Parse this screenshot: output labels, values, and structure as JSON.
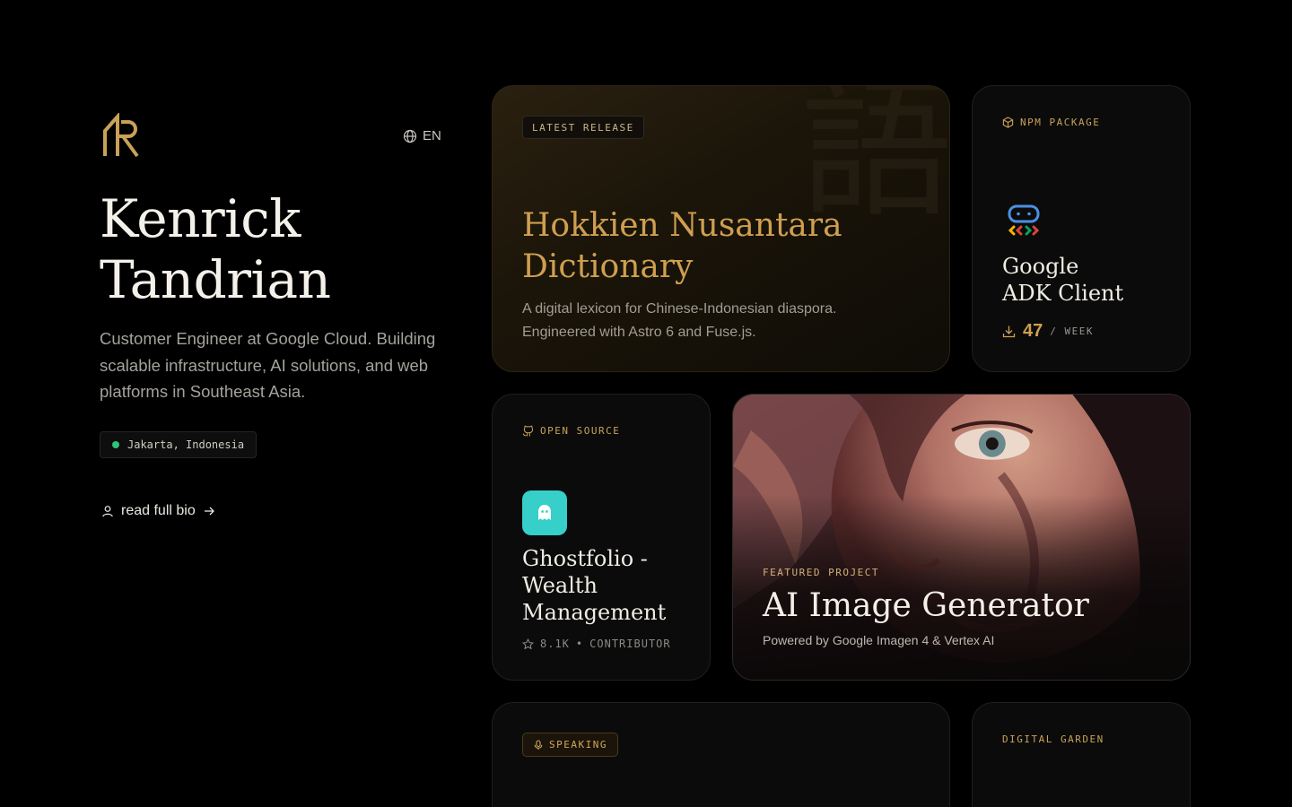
{
  "header": {
    "language": "EN"
  },
  "profile": {
    "name_line1": "Kenrick",
    "name_line2": "Tandrian",
    "bio": "Customer Engineer at Google Cloud. Building scalable infrastructure, AI solutions, and web platforms in Southeast Asia.",
    "location": "Jakarta, Indonesia",
    "read_bio_label": "read full bio"
  },
  "cards": {
    "release": {
      "tag": "LATEST RELEASE",
      "background_glyph": "語",
      "title": "Hokkien Nusantara Dictionary",
      "description": "A digital lexicon for Chinese-Indonesian diaspora. Engineered with Astro 6 and Fuse.js."
    },
    "npm": {
      "tag": "NPM PACKAGE",
      "title_line1": "Google",
      "title_line2": "ADK Client",
      "downloads": "47",
      "downloads_unit": "/ WEEK"
    },
    "open_source": {
      "tag": "OPEN SOURCE",
      "title": "Ghostfolio - Wealth Management",
      "stars": "8.1K",
      "separator": "•",
      "role": "CONTRIBUTOR"
    },
    "featured": {
      "tag": "FEATURED PROJECT",
      "title": "AI Image Generator",
      "description": "Powered by Google Imagen 4 & Vertex AI"
    },
    "speaking": {
      "tag": "SPEAKING"
    },
    "garden": {
      "tag": "DIGITAL GARDEN"
    }
  },
  "colors": {
    "accent": "#cf9f50",
    "background": "#000000",
    "status_online": "#2fc27a",
    "ghostfolio": "#36cfc9"
  },
  "icons": [
    "logo-icon",
    "globe-icon",
    "user-icon",
    "arrow-right-icon",
    "package-icon",
    "adk-icon",
    "download-icon",
    "github-icon",
    "ghost-icon",
    "star-icon",
    "microphone-icon"
  ]
}
